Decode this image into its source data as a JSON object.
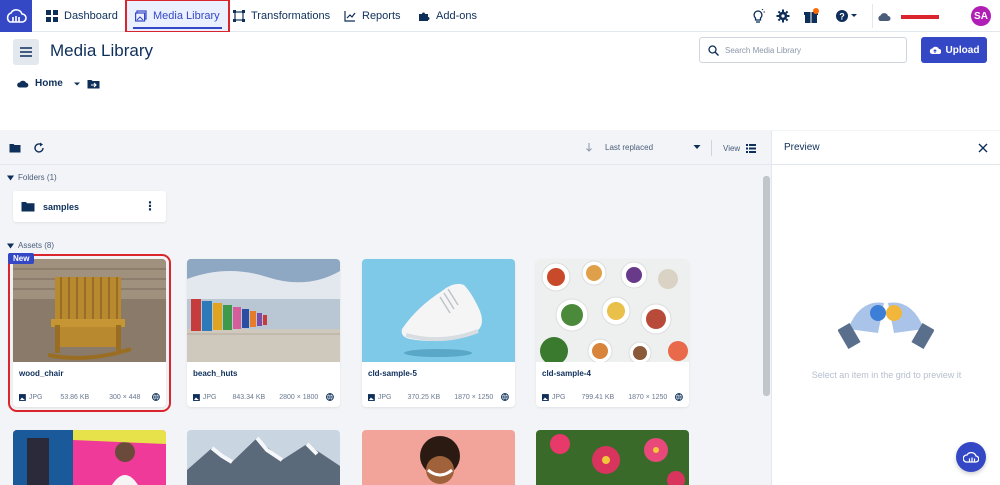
{
  "nav": {
    "items": [
      {
        "label": "Dashboard",
        "icon": "dashboard-icon"
      },
      {
        "label": "Media Library",
        "icon": "media-library-icon"
      },
      {
        "label": "Transformations",
        "icon": "transform-icon"
      },
      {
        "label": "Reports",
        "icon": "chart-icon"
      },
      {
        "label": "Add-ons",
        "icon": "puzzle-icon"
      }
    ],
    "avatar_initials": "SA"
  },
  "header": {
    "title": "Media Library",
    "search_placeholder": "Search Media Library",
    "upload_label": "Upload",
    "breadcrumb": "Home"
  },
  "toolbar": {
    "sort_label": "Last replaced",
    "view_label": "View"
  },
  "folders": {
    "label": "Folders (1)",
    "items": [
      {
        "name": "samples"
      }
    ]
  },
  "assets": {
    "label": "Assets (8)",
    "new_badge": "New",
    "items": [
      {
        "name": "wood_chair",
        "format": "JPG",
        "size": "53.86 KB",
        "dims": "300 × 448"
      },
      {
        "name": "beach_huts",
        "format": "JPG",
        "size": "843.34 KB",
        "dims": "2800 × 1800"
      },
      {
        "name": "cld-sample-5",
        "format": "JPG",
        "size": "370.25 KB",
        "dims": "1870 × 1250"
      },
      {
        "name": "cld-sample-4",
        "format": "JPG",
        "size": "799.41 KB",
        "dims": "1870 × 1250"
      }
    ]
  },
  "preview": {
    "title": "Preview",
    "empty_text": "Select an item in the grid to preview it"
  },
  "colors": {
    "brand": "#3448c5",
    "highlight": "#d9252b",
    "navy": "#0e2f5a"
  }
}
